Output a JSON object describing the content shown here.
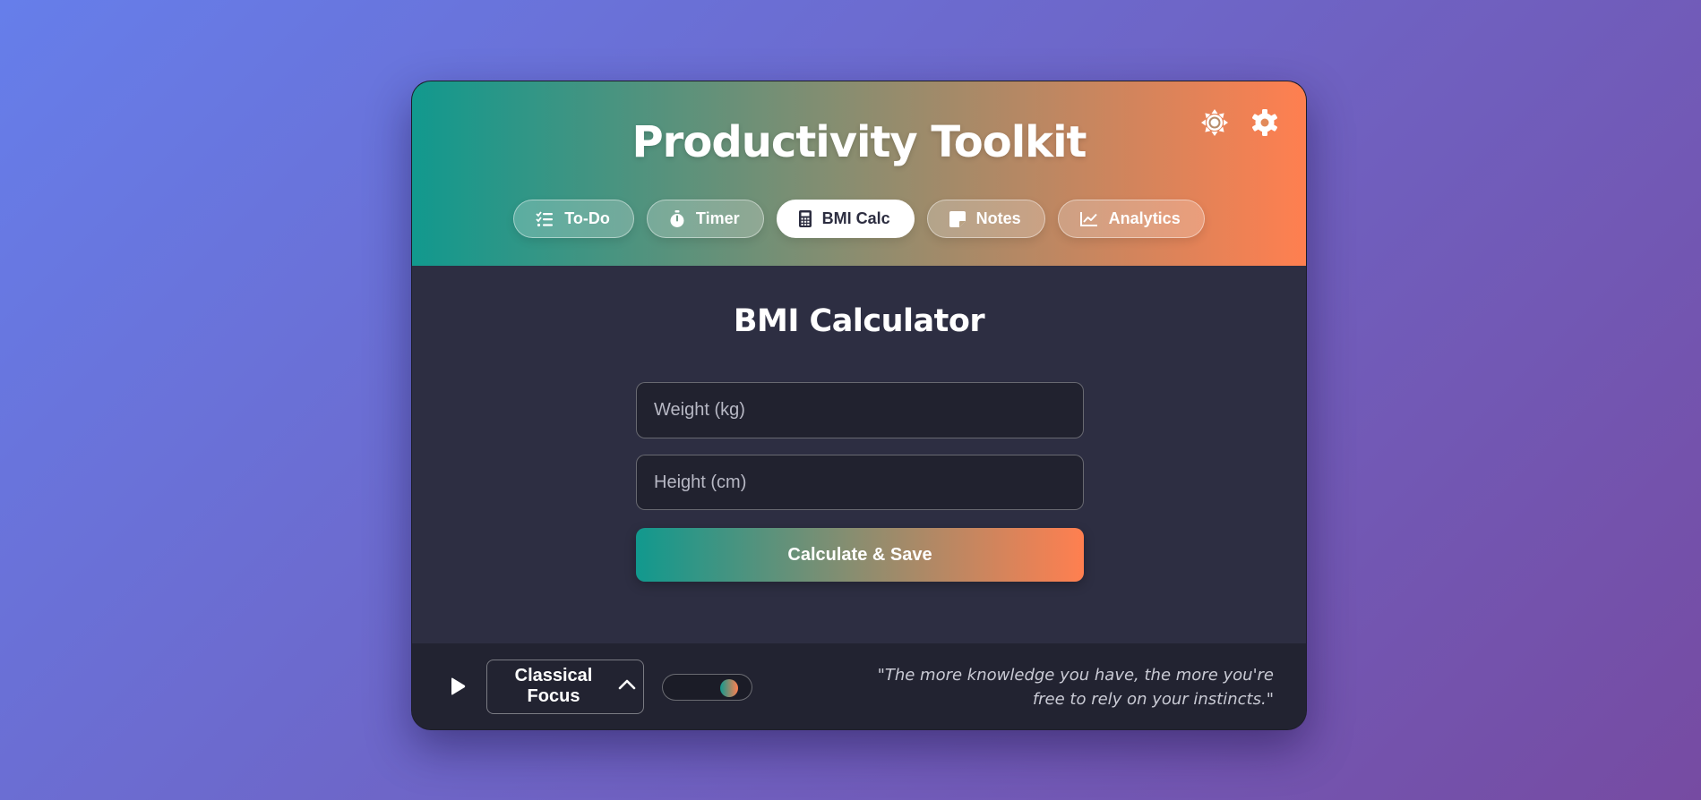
{
  "app": {
    "title": "Productivity Toolkit",
    "header_icons": [
      "sun-icon",
      "gear-icon"
    ]
  },
  "tabs": [
    {
      "label": "To-Do",
      "icon": "checklist-icon",
      "active": false
    },
    {
      "label": "Timer",
      "icon": "stopwatch-icon",
      "active": false
    },
    {
      "label": "BMI Calc",
      "icon": "calculator-icon",
      "active": true
    },
    {
      "label": "Notes",
      "icon": "sticky-note-icon",
      "active": false
    },
    {
      "label": "Analytics",
      "icon": "chart-line-icon",
      "active": false
    }
  ],
  "bmi": {
    "title": "BMI Calculator",
    "weight_placeholder": "Weight (kg)",
    "weight_value": "",
    "height_placeholder": "Height (cm)",
    "height_value": "",
    "button_label": "Calculate & Save"
  },
  "footer": {
    "play_icon": "play-icon",
    "track": "Classical Focus",
    "track_chevron": "chevron-up-icon",
    "volume": 0.85,
    "quote": "\"The more knowledge you have, the more you're free to rely on your instincts.\""
  },
  "colors": {
    "gradient_start": "#11998e",
    "gradient_end": "#ff7f50",
    "background_start": "#667eea",
    "background_end": "#764ba2",
    "panel": "#2d2e42",
    "footer": "#222331"
  }
}
